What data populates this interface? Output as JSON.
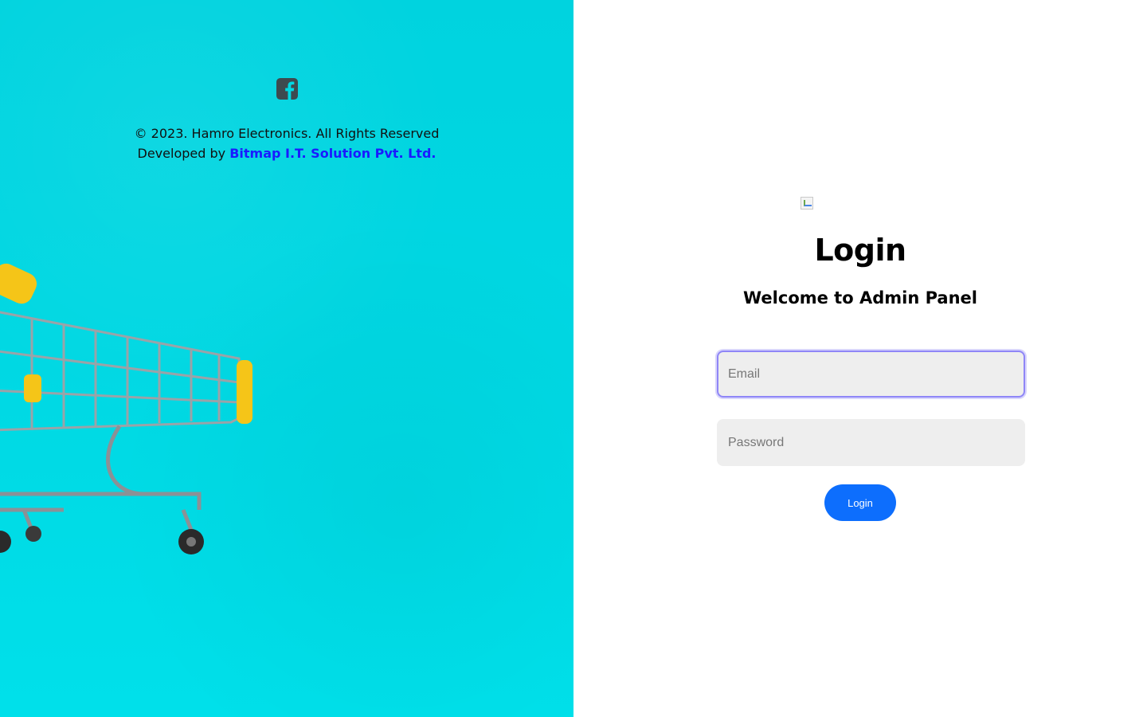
{
  "left": {
    "footer": {
      "copyright": "© 2023. Hamro Electronics. All Rights Reserved",
      "developed_by_prefix": "Developed by ",
      "developer_name": "Bitmap I.T. Solution Pvt. Ltd."
    },
    "social_icon": "facebook-icon",
    "background_color": "#00d8e3"
  },
  "login": {
    "title": "Login",
    "subtitle": "Welcome to Admin Panel",
    "email_placeholder": "Email",
    "email_value": "",
    "password_placeholder": "Password",
    "password_value": "",
    "button_label": "Login",
    "button_color": "#0d6efd"
  }
}
